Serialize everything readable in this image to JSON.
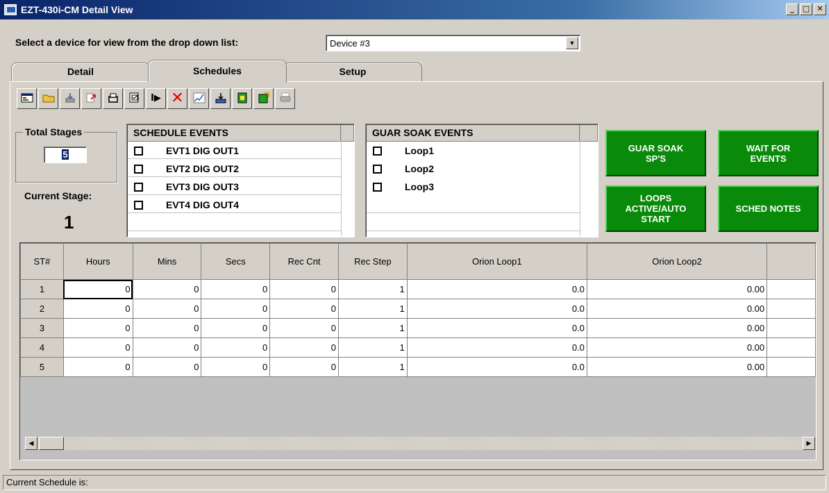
{
  "window": {
    "title": "EZT-430i-CM Detail View",
    "controls": [
      "_",
      "□",
      "✕"
    ]
  },
  "device": {
    "label": "Select a device for view from the drop down list:",
    "selected": "Device #3"
  },
  "tabs": [
    {
      "label": "Detail"
    },
    {
      "label": "Schedules"
    },
    {
      "label": "Setup"
    }
  ],
  "toolbar": {
    "buttons": [
      {
        "icon": "new-schedule-icon"
      },
      {
        "icon": "open-folder-icon"
      },
      {
        "icon": "download-icon"
      },
      {
        "icon": "upload-icon"
      },
      {
        "icon": "edit-icon"
      },
      {
        "icon": "save-icon"
      },
      {
        "icon": "play-icon"
      },
      {
        "icon": "delete-icon"
      },
      {
        "icon": "chart-icon"
      },
      {
        "icon": "export-icon"
      },
      {
        "icon": "insert-step-icon"
      },
      {
        "icon": "remove-step-icon"
      },
      {
        "icon": "print-icon"
      }
    ]
  },
  "total_stages": {
    "label": "Total Stages",
    "value": "5"
  },
  "current_stage": {
    "label": "Current Stage:",
    "value": "1"
  },
  "schedule_events": {
    "header": "SCHEDULE EVENTS",
    "items": [
      "EVT1 DIG OUT1",
      "EVT2 DIG OUT2",
      "EVT3 DIG OUT3",
      "EVT4 DIG OUT4"
    ]
  },
  "guar_soak_events": {
    "header": "GUAR SOAK EVENTS",
    "items": [
      "Loop1",
      "Loop2",
      "Loop3"
    ]
  },
  "buttons": {
    "guar_soak": "GUAR SOAK\nSP'S",
    "wait_events": "WAIT FOR\nEVENTS",
    "loops_active": "LOOPS\nACTIVE/AUTO\nSTART",
    "sched_notes": "SCHED NOTES"
  },
  "grid": {
    "columns": [
      "ST#",
      "Hours",
      "Mins",
      "Secs",
      "Rec Cnt",
      "Rec Step",
      "Orion Loop1",
      "Orion Loop2"
    ],
    "rows": [
      [
        "1",
        "0",
        "0",
        "0",
        "0",
        "1",
        "0.0",
        "0.00"
      ],
      [
        "2",
        "0",
        "0",
        "0",
        "0",
        "1",
        "0.0",
        "0.00"
      ],
      [
        "3",
        "0",
        "0",
        "0",
        "0",
        "1",
        "0.0",
        "0.00"
      ],
      [
        "4",
        "0",
        "0",
        "0",
        "0",
        "1",
        "0.0",
        "0.00"
      ],
      [
        "5",
        "0",
        "0",
        "0",
        "0",
        "1",
        "0.0",
        "0.00"
      ]
    ]
  },
  "status": {
    "text": "Current Schedule is:"
  }
}
